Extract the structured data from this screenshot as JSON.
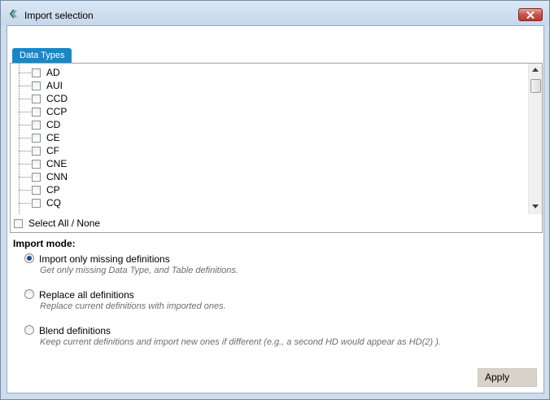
{
  "window": {
    "title": "Import selection"
  },
  "tab": {
    "label": "Data Types"
  },
  "data_types": [
    "AD",
    "AUI",
    "CCD",
    "CCP",
    "CD",
    "CE",
    "CF",
    "CNE",
    "CNN",
    "CP",
    "CQ"
  ],
  "select_all": {
    "label": "Select All / None"
  },
  "import_mode": {
    "title": "Import mode:",
    "options": [
      {
        "label": "Import only missing definitions",
        "description": "Get only missing Data Type, and Table definitions.",
        "selected": true
      },
      {
        "label": "Replace all definitions",
        "description": "Replace current definitions with imported ones.",
        "selected": false
      },
      {
        "label": "Blend definitions",
        "description": "Keep current definitions and import new ones if different (e.g., a second HD would appear as HD(2) ).",
        "selected": false
      }
    ]
  },
  "buttons": {
    "apply": "Apply"
  }
}
